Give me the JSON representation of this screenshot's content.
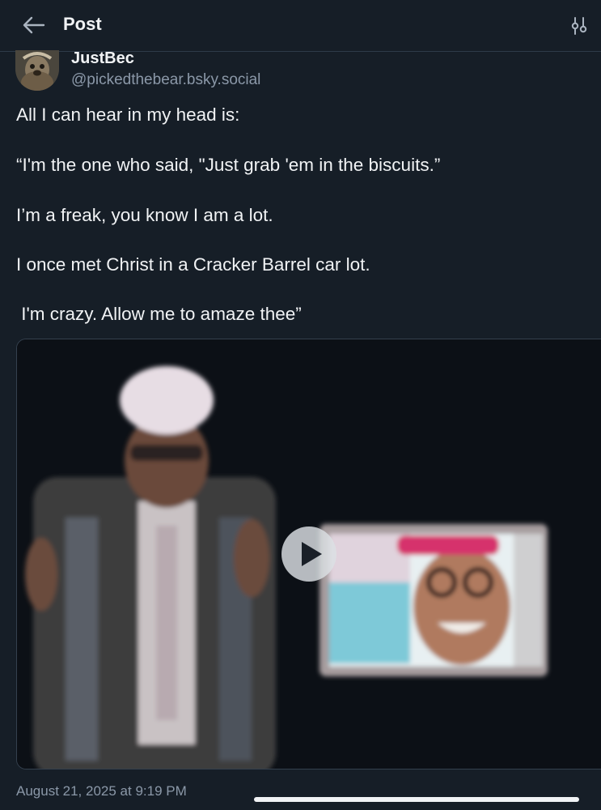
{
  "header": {
    "title": "Post",
    "back_icon": "arrow-left-icon",
    "filter_icon": "sliders-icon"
  },
  "post": {
    "author": {
      "display_name": "JustBec",
      "handle": "@pickedthebear.bsky.social",
      "avatar_icon": "avatar-image"
    },
    "lines": [
      "All I can hear in my head is:",
      "“I'm the one who said, \"Just grab 'em in the biscuits.”",
      "I’m a freak, you know I am a lot.",
      "I once met Christ in a Cracker Barrel car lot.",
      " I'm crazy. Allow me to amaze thee”"
    ],
    "video": {
      "play_icon": "play-icon"
    },
    "timestamp": "August 21, 2025 at 9:19 PM"
  },
  "colors": {
    "background": "#161e27",
    "text": "#f1f3f5",
    "muted": "#8b98a8",
    "divider": "#2e3a48"
  }
}
